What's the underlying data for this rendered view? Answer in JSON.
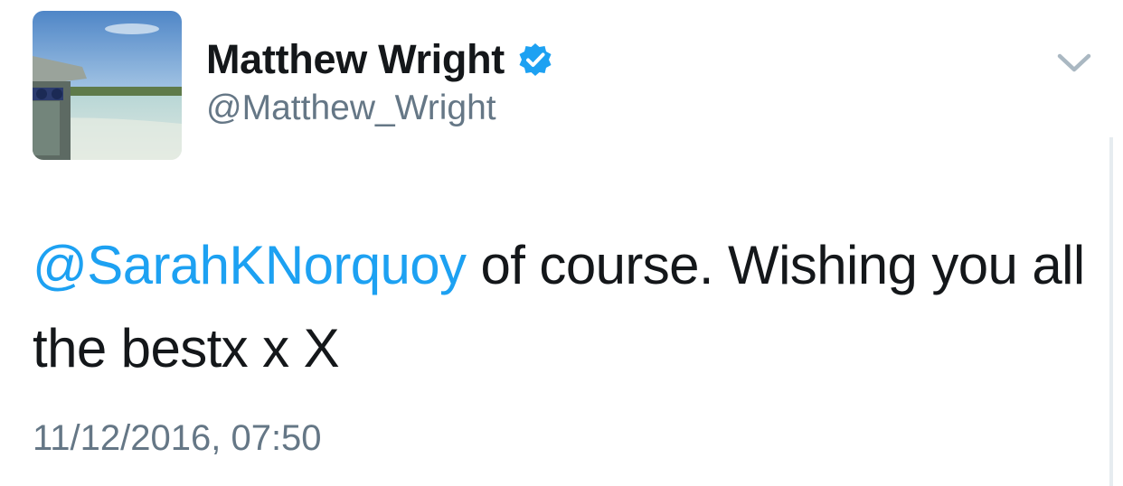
{
  "tweet": {
    "author": {
      "display_name": "Matthew Wright",
      "handle": "@Matthew_Wright",
      "verified": true
    },
    "text": {
      "mention": "@SarahKNorquoy",
      "body": " of course. Wishing you all the bestx x X"
    },
    "timestamp": "11/12/2016, 07:50"
  },
  "colors": {
    "link_blue": "#1da1f2",
    "text_primary": "#14171a",
    "text_secondary": "#657786",
    "chevron": "#aab8c2"
  },
  "icons": {
    "verified": "verified-badge-icon",
    "menu": "chevron-down-icon"
  }
}
